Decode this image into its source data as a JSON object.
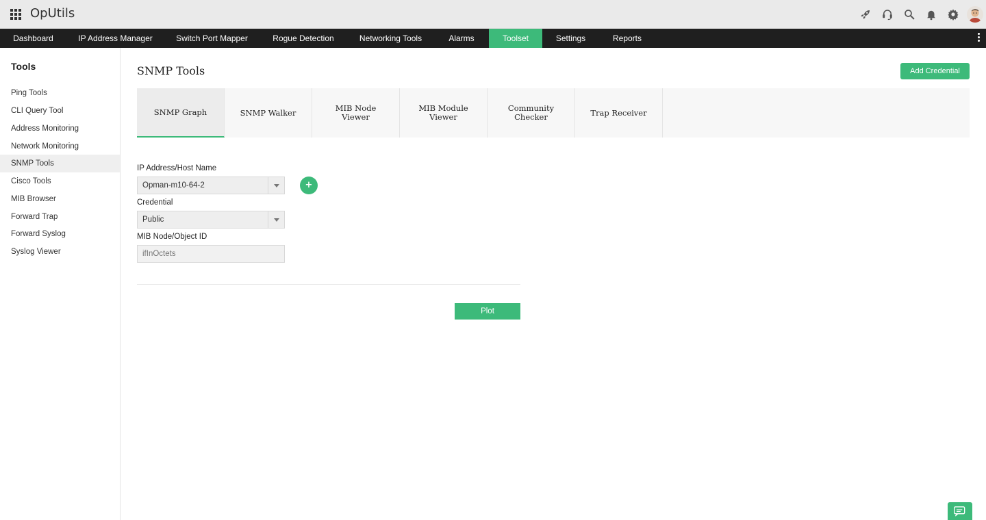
{
  "header": {
    "brand": "OpUtils",
    "icons": [
      "apps-grid-icon",
      "rocket-icon",
      "headset-icon",
      "search-icon",
      "bell-icon",
      "gear-icon",
      "user-avatar"
    ]
  },
  "nav": {
    "items": [
      {
        "label": "Dashboard"
      },
      {
        "label": "IP Address Manager"
      },
      {
        "label": "Switch Port Mapper"
      },
      {
        "label": "Rogue Detection"
      },
      {
        "label": "Networking Tools"
      },
      {
        "label": "Alarms"
      },
      {
        "label": "Toolset"
      },
      {
        "label": "Settings"
      },
      {
        "label": "Reports"
      }
    ],
    "active": "Toolset"
  },
  "sidebar": {
    "title": "Tools",
    "items": [
      {
        "label": "Ping Tools"
      },
      {
        "label": "CLI Query Tool"
      },
      {
        "label": "Address Monitoring"
      },
      {
        "label": "Network Monitoring"
      },
      {
        "label": "SNMP Tools"
      },
      {
        "label": "Cisco Tools"
      },
      {
        "label": "MIB Browser"
      },
      {
        "label": "Forward Trap"
      },
      {
        "label": "Forward Syslog"
      },
      {
        "label": "Syslog Viewer"
      }
    ],
    "active": "SNMP Tools"
  },
  "main": {
    "title": "SNMP Tools",
    "add_credential_label": "Add Credential",
    "tabs": [
      {
        "label": "SNMP Graph"
      },
      {
        "label": "SNMP Walker"
      },
      {
        "label": "MIB Node Viewer"
      },
      {
        "label": "MIB Module Viewer"
      },
      {
        "label": "Community Checker"
      },
      {
        "label": "Trap Receiver"
      }
    ],
    "active_tab": "SNMP Graph",
    "form": {
      "host_label": "IP Address/Host Name",
      "host_value": "Opman-m10-64-2",
      "credential_label": "Credential",
      "credential_value": "Public",
      "mib_label": "MIB Node/Object ID",
      "mib_placeholder": "ifInOctets",
      "add_symbol": "+",
      "plot_label": "Plot"
    }
  },
  "colors": {
    "accent": "#3dba7a",
    "navbar_bg": "#1f1f1f",
    "topbar_bg": "#eaeaea"
  }
}
